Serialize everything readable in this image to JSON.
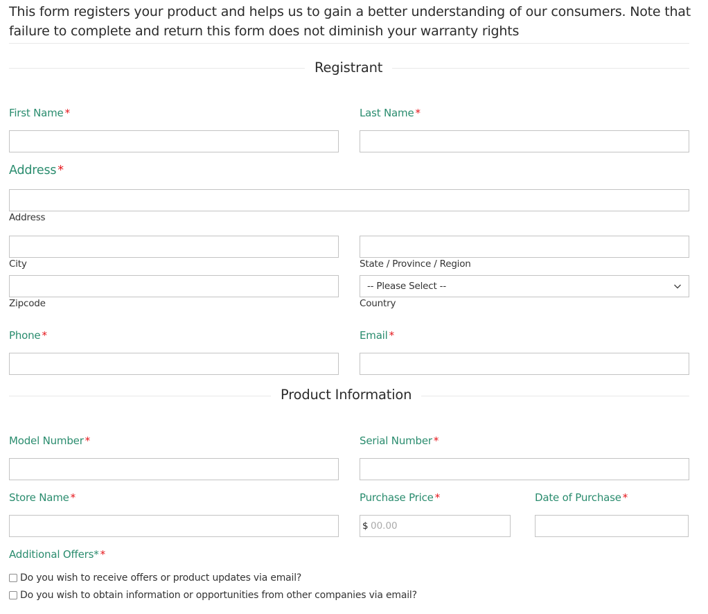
{
  "intro": "This form registers your product and helps us to gain a better understanding of our consumers. Note that failure to complete and return this form does not diminish your warranty rights",
  "sections": {
    "registrant": "Registrant",
    "product": "Product Information"
  },
  "required_marker": "*",
  "fields": {
    "first_name": {
      "label": "First Name",
      "value": ""
    },
    "last_name": {
      "label": "Last Name",
      "value": ""
    },
    "address": {
      "label": "Address",
      "address_line": {
        "sublabel": "Address",
        "value": ""
      },
      "city": {
        "sublabel": "City",
        "value": ""
      },
      "state": {
        "sublabel": "State / Province / Region",
        "value": ""
      },
      "zipcode": {
        "sublabel": "Zipcode",
        "value": ""
      },
      "country": {
        "sublabel": "Country",
        "selected": "-- Please Select --"
      }
    },
    "phone": {
      "label": "Phone",
      "value": ""
    },
    "email": {
      "label": "Email",
      "value": ""
    },
    "model_number": {
      "label": "Model Number",
      "value": ""
    },
    "serial_number": {
      "label": "Serial Number",
      "value": ""
    },
    "store_name": {
      "label": "Store Name",
      "value": ""
    },
    "purchase_price": {
      "label": "Purchase Price",
      "prefix": "$",
      "placeholder": "00.00",
      "value": ""
    },
    "date_of_purchase": {
      "label": "Date of Purchase",
      "value": ""
    },
    "additional_offers": {
      "label": "Additional Offers*",
      "options": [
        {
          "label": "Do you wish to receive offers or product updates via email?",
          "checked": false
        },
        {
          "label": "Do you wish to obtain information or opportunities from other companies via email?",
          "checked": false
        }
      ]
    }
  },
  "colors": {
    "label": "#2a8c6e",
    "required": "#e5161b",
    "border": "#c3c3c3"
  }
}
